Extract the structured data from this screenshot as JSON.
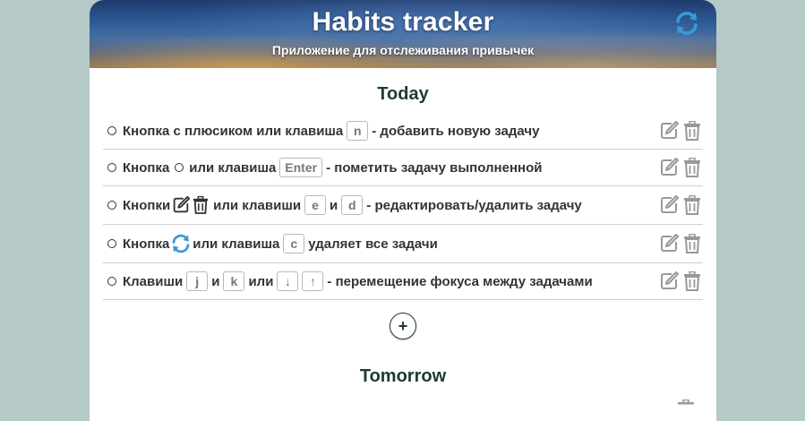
{
  "header": {
    "title": "Habits tracker",
    "subtitle": "Приложение для отслеживания привычек",
    "refresh_icon": "refresh-icon"
  },
  "sections": {
    "today": "Today",
    "tomorrow": "Tomorrow"
  },
  "tasks": [
    {
      "parts": {
        "a": "Кнопка с плюсиком или клавиша",
        "key1": "n",
        "b": "- добавить новую задачу"
      }
    },
    {
      "parts": {
        "a": "Кнопка",
        "b": "или клавиша",
        "key1": "Enter",
        "c": "- пометить задачу выполненной"
      }
    },
    {
      "parts": {
        "a": "Кнопки",
        "b": "или клавиши",
        "key1": "e",
        "c": "и",
        "key2": "d",
        "d": "- редактировать/удалить задачу"
      }
    },
    {
      "parts": {
        "a": "Кнопка",
        "b": "или клавиша",
        "key1": "c",
        "c": "удаляет все задачи"
      }
    },
    {
      "parts": {
        "a": "Клавиши",
        "key1": "j",
        "b": "и",
        "key2": "k",
        "c": "или",
        "key3": "↓",
        "key4": "↑",
        "d": "- перемещение фокуса между задачами"
      }
    }
  ],
  "add_button_label": "+",
  "colors": {
    "page_bg": "#b5c9c6",
    "refresh_accent": "#3a9ad9",
    "heading": "#1f3a33"
  }
}
